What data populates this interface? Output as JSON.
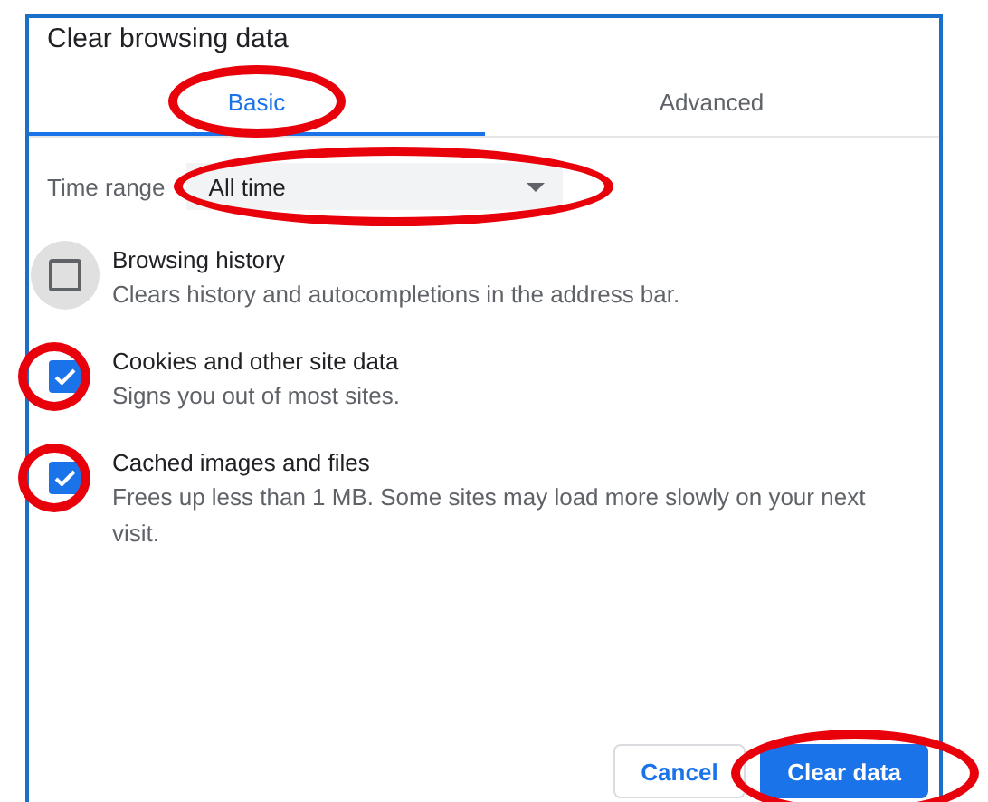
{
  "dialog": {
    "title": "Clear browsing data"
  },
  "tabs": [
    {
      "label": "Basic",
      "selected": true,
      "highlighted": true
    },
    {
      "label": "Advanced",
      "selected": false,
      "highlighted": false
    }
  ],
  "time_range": {
    "label": "Time range",
    "value": "All time",
    "highlighted": true
  },
  "items": [
    {
      "title": "Browsing history",
      "description": "Clears history and autocompletions in the address bar.",
      "checked": false,
      "focused": true,
      "highlighted": false
    },
    {
      "title": "Cookies and other site data",
      "description": "Signs you out of most sites.",
      "checked": true,
      "focused": false,
      "highlighted": true
    },
    {
      "title": "Cached images and files",
      "description": "Frees up less than 1 MB. Some sites may load more slowly on your next visit.",
      "checked": true,
      "focused": false,
      "highlighted": true
    }
  ],
  "buttons": [
    {
      "label": "Cancel",
      "kind": "secondary",
      "highlighted": false
    },
    {
      "label": "Clear data",
      "kind": "primary",
      "highlighted": true
    }
  ]
}
